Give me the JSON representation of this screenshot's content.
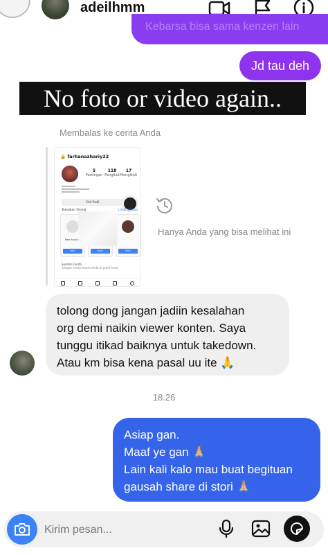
{
  "header": {
    "username": "adeilhmm",
    "icons": [
      "video-call-icon",
      "flag-icon",
      "info-icon"
    ]
  },
  "messages": {
    "outgoing_top_partial": "Kebarsa bisa sama kenzen lain",
    "outgoing_1": "Jd tau deh",
    "caption_overlay": "No foto or video again..",
    "reply_label": "Membalas ke cerita Anda",
    "story_preview": {
      "username": "farhanazhariy22",
      "stats": [
        {
          "value": "5",
          "label": "Postingan"
        },
        {
          "value": "118",
          "label": "Pengikut"
        },
        {
          "value": "17",
          "label": "Mengikuti"
        }
      ],
      "edit_profile": "Edit Profil",
      "discover_label": "Temukan Orang",
      "see_all": "Lihat Semua",
      "cards": [
        {
          "name": "New account!",
          "follow": "Ikuti"
        },
        {
          "name": "ahmad fauzi",
          "follow": "Ikuti"
        },
        {
          "name": "",
          "follow": "Ikuti"
        }
      ],
      "bottom_section": "Sorotan Cerita",
      "bottom_sub": "Simpan cerita favorit Anda di profil Anda"
    },
    "only_you_label": "Hanya Anda yang bisa melihat ini",
    "incoming_lines": [
      "tolong dong jangan jadiin kesalahan",
      "org demi naikin viewer konten. Saya",
      "tunggu itikad baiknya untuk takedown.",
      "Atau km bisa kena pasal uu ite 🙏"
    ],
    "timestamp": "18.26",
    "outgoing_lines": [
      "Asiap gan.",
      "Maaf ye gan 🙏🏼",
      "Lain kali kalo mau buat begituan",
      "gausah share di stori 🙏🏼"
    ]
  },
  "composer": {
    "placeholder": "Kirim pesan..."
  },
  "colors": {
    "purple_bubble": "#8e33ee",
    "blue_bubble": "#3563e9",
    "gray_bubble": "#efefef",
    "camera_button": "#3b82f6"
  }
}
